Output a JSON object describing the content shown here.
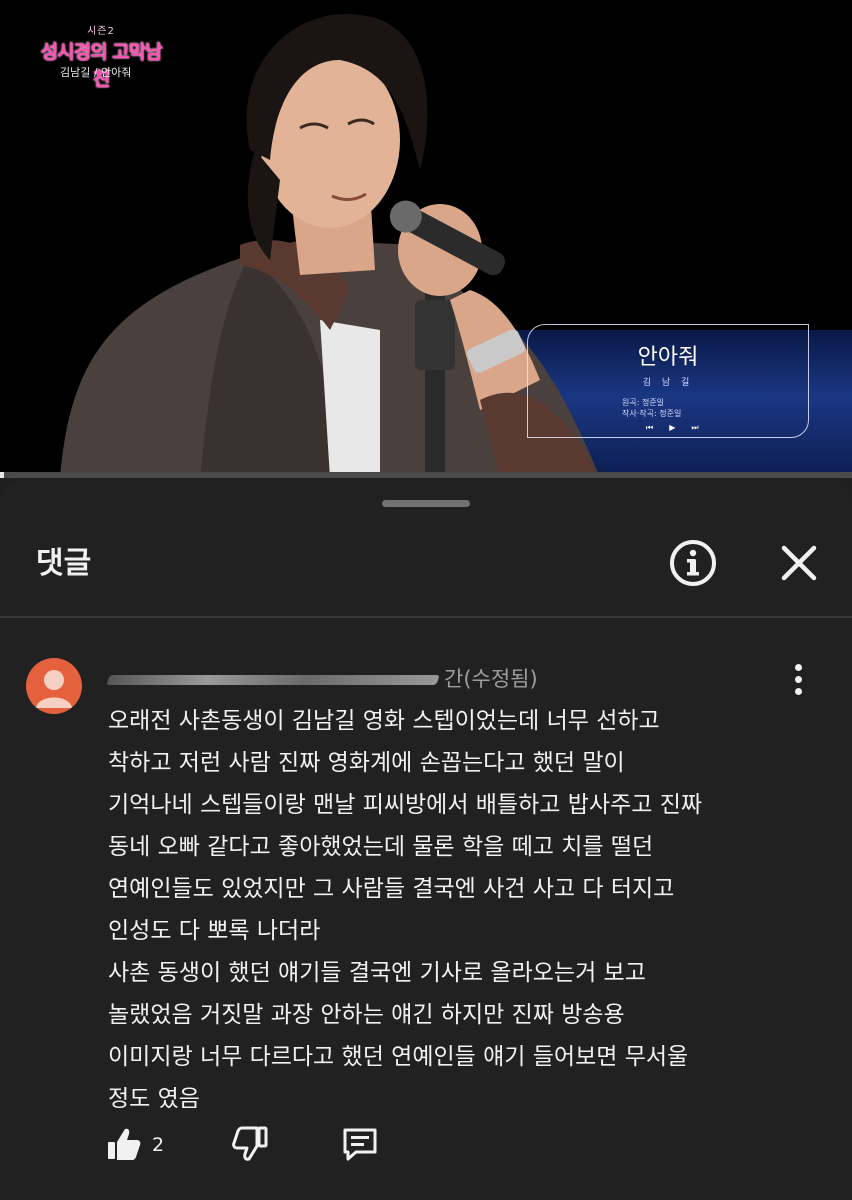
{
  "video": {
    "show_logo_small": "시즌2",
    "show_logo": "성시경의 고막남친",
    "show_subtitle": "김남길 / 안아줘",
    "song_title": "안아줘",
    "song_artist": "김 남 길",
    "song_credit_1": "원곡: 정준일",
    "song_credit_2": "작사·작곡: 정준일",
    "progress_fraction": 0.005
  },
  "panel": {
    "title": "댓글",
    "info_icon": "info-icon",
    "close_icon": "close-icon"
  },
  "comment": {
    "meta_visible": "간(수정됨)",
    "author_redacted": true,
    "lines": [
      "오래전 사촌동생이 김남길 영화 스텝이었는데  너무 선하고",
      "착하고 저런 사람 진짜 영화계에 손꼽는다고 했던 말이",
      "기억나네 스텝들이랑 맨날 피씨방에서 배틀하고 밥사주고 진짜",
      "동네 오빠 같다고 좋아했었는데 물론 학을 떼고 치를 떨던",
      "연예인들도 있었지만 그 사람들  결국엔 사건 사고 다 터지고",
      "인성도 다 뽀록 나더라",
      "사촌 동생이 했던 얘기들 결국엔 기사로 올라오는거 보고",
      "놀랬었음 거짓말 과장 안하는 얘긴 하지만 진짜 방송용",
      "이미지랑 너무 다르다고 했던 연예인들 얘기 들어보면 무서울",
      "정도 였음"
    ],
    "like_count": "2",
    "avatar_color": "#e5613d"
  },
  "colors": {
    "panel_bg": "#212121",
    "text": "#f1f1f1",
    "muted": "#9e9e9e",
    "avatar": "#e5613d",
    "show_logo": "#ff4fb3"
  }
}
